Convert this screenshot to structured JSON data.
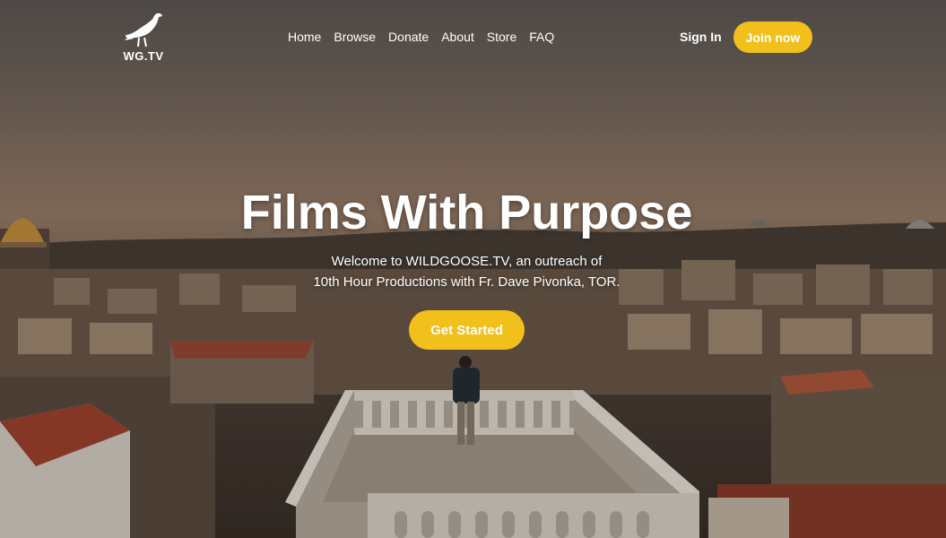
{
  "header": {
    "logo_text": "WG.TV",
    "logo_icon": "goose-icon",
    "nav": [
      "Home",
      "Browse",
      "Donate",
      "About",
      "Store",
      "FAQ"
    ],
    "sign_in": "Sign In",
    "join": "Join now"
  },
  "hero": {
    "title": "Films With Purpose",
    "subtitle_line1": "Welcome to WILDGOOSE.TV, an outreach of",
    "subtitle_line2": "10th Hour Productions with Fr. Dave Pivonka, TOR.",
    "cta": "Get Started"
  },
  "colors": {
    "accent": "#f2c01b",
    "text": "#ffffff"
  }
}
